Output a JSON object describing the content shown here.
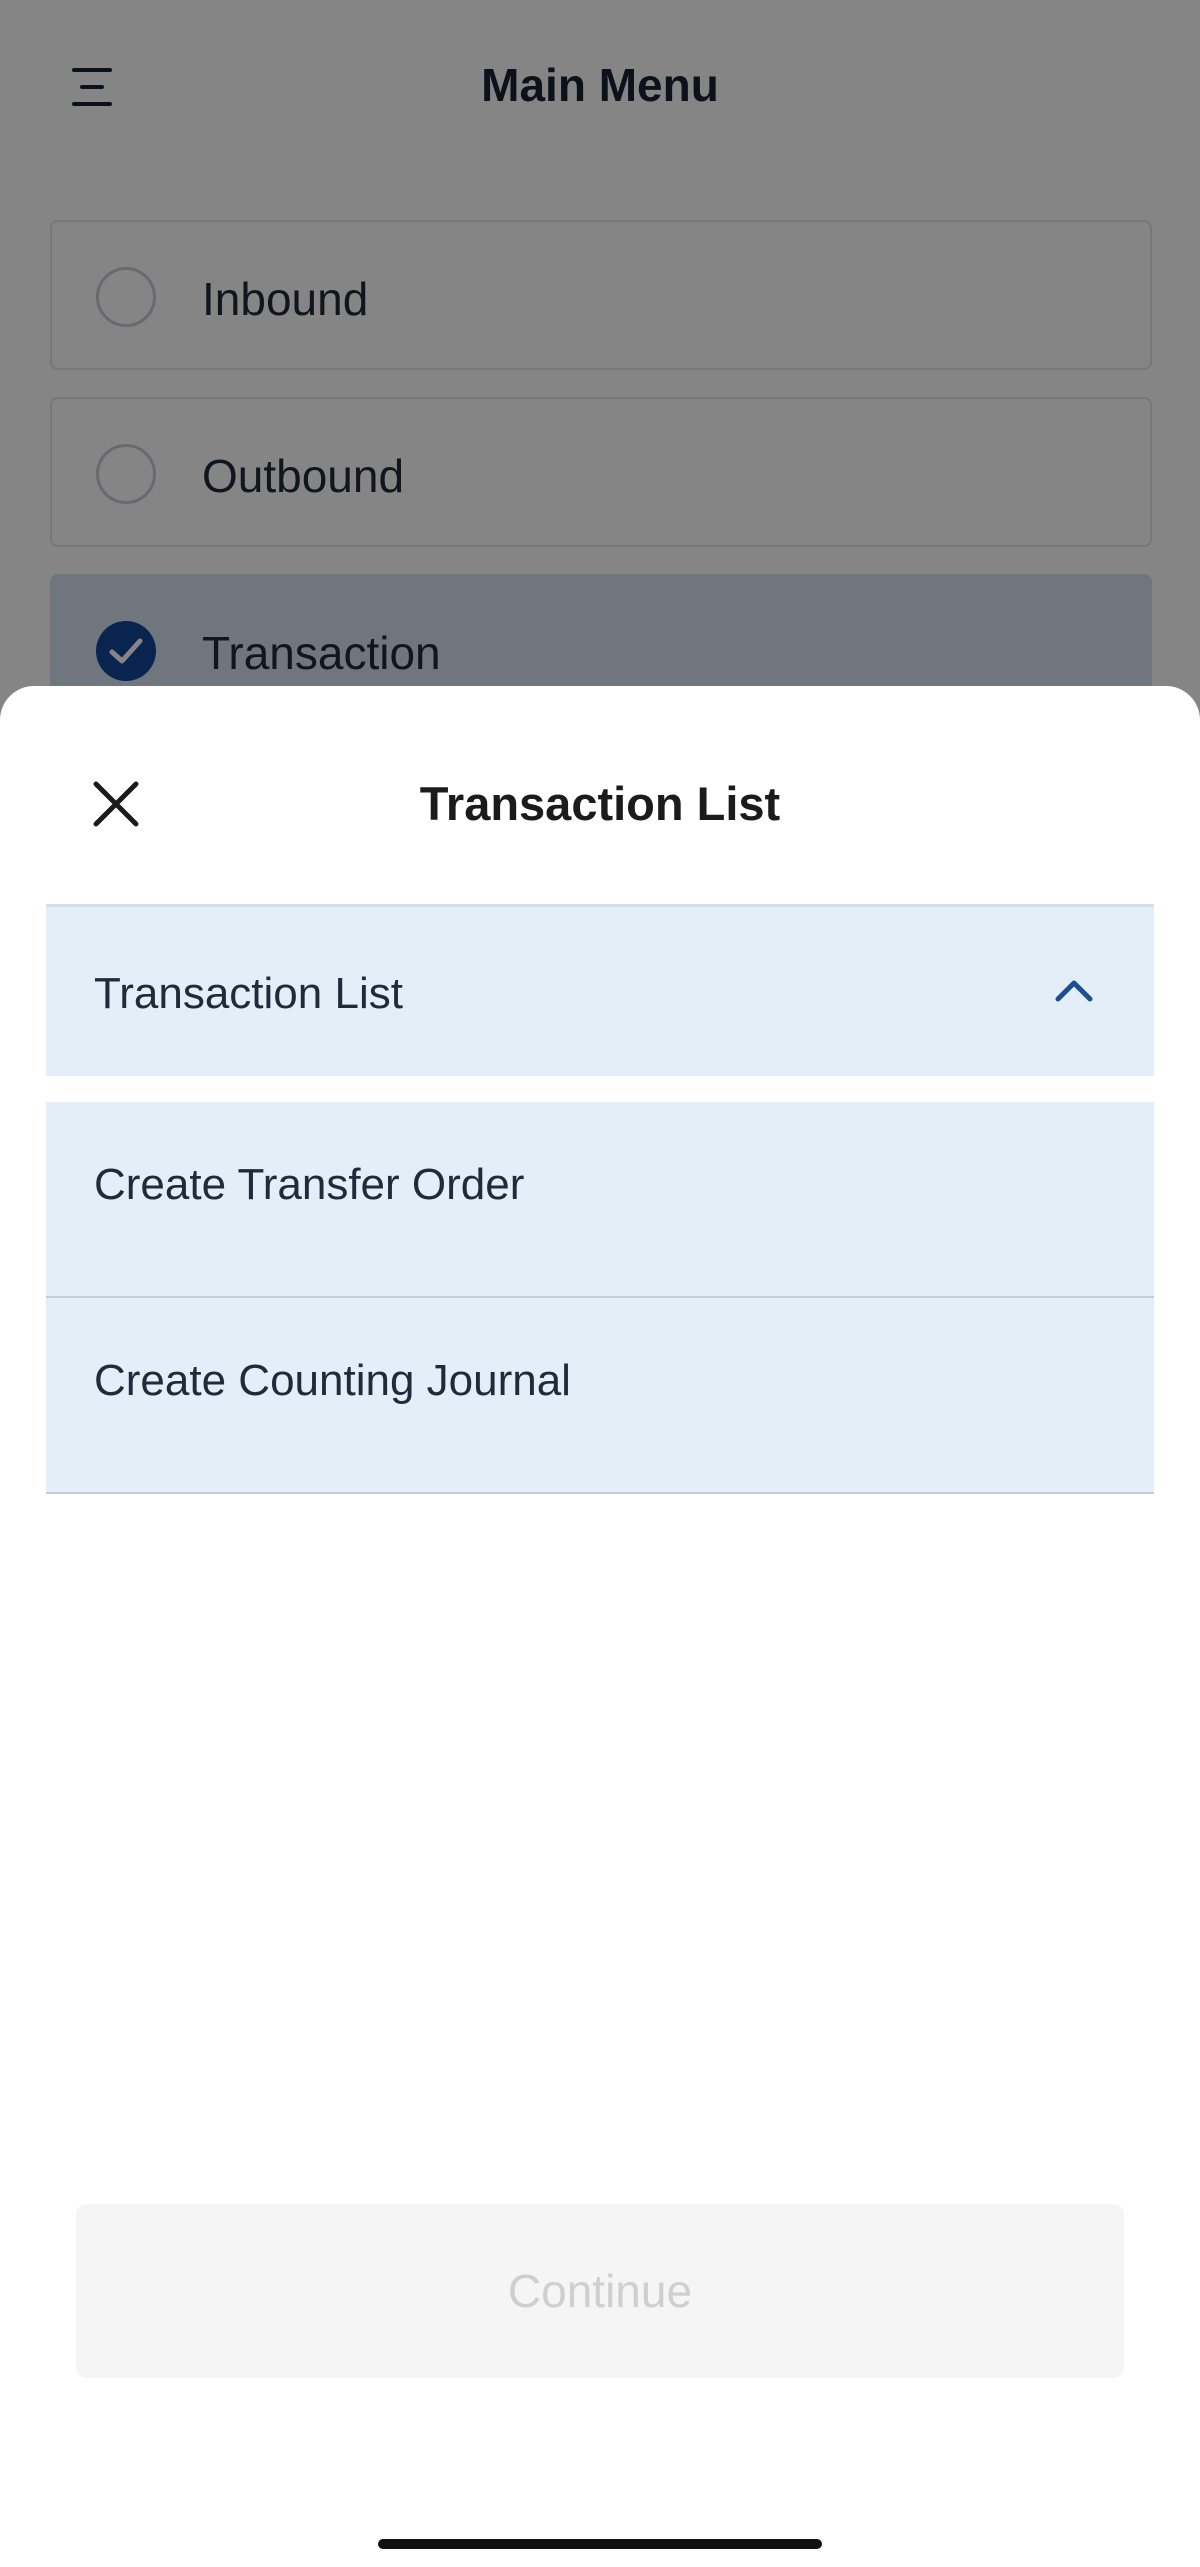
{
  "main_menu": {
    "title": "Main Menu",
    "menu_icon": "menu-icon",
    "options": [
      {
        "label": "Inbound",
        "selected": false
      },
      {
        "label": "Outbound",
        "selected": false
      },
      {
        "label": "Transaction",
        "selected": true
      }
    ]
  },
  "sheet": {
    "title": "Transaction List",
    "close_icon": "close-icon",
    "accordion": {
      "title": "Transaction List",
      "expanded": true,
      "chevron_icon": "chevron-up-icon",
      "items": [
        {
          "label": "Create Transfer Order"
        },
        {
          "label": "Create Counting Journal"
        }
      ]
    },
    "continue_label": "Continue",
    "continue_enabled": false
  },
  "colors": {
    "accent": "#14469a",
    "accordion_bg": "#e4eef9",
    "disabled_button_bg": "#f5f5f5",
    "disabled_button_text": "#cfcfcf"
  }
}
